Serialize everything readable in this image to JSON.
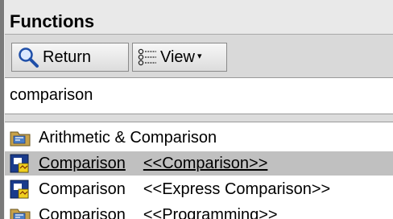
{
  "palette": {
    "title": "Functions"
  },
  "toolbar": {
    "return_label": "Return",
    "view_label": "View",
    "view_arrow": "▾"
  },
  "search": {
    "value": "comparison"
  },
  "results": {
    "items": [
      {
        "name": "Arithmetic & Comparison",
        "path": "",
        "icon": "folder-icon"
      },
      {
        "name": "Comparison",
        "path": "<<Comparison>>",
        "icon": "express-vi-icon",
        "selected": true
      },
      {
        "name": "Comparison",
        "path": "<<Express Comparison>>",
        "icon": "express-vi-icon"
      },
      {
        "name": "Comparison",
        "path": "<<Programming>>",
        "icon": "folder-icon"
      }
    ]
  },
  "colors": {
    "selection": "#c0c0c0",
    "folder": "#c8a24a",
    "express_vi_blue": "#1a3b8c",
    "express_vi_yellow": "#f0d020"
  }
}
